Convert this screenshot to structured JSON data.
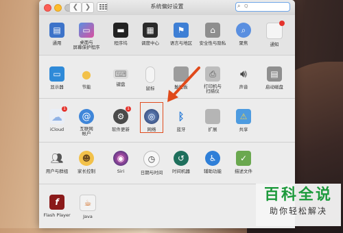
{
  "window": {
    "title": "系统偏好设置",
    "search_placeholder": "Q"
  },
  "rows": [
    {
      "items": [
        {
          "label": "通用",
          "icon": "file-new-icon"
        },
        {
          "label": "桌面与\n屏幕保护程序",
          "icon": "desktop-icon"
        },
        {
          "label": "程序坞",
          "icon": "dock-icon"
        },
        {
          "label": "调度中心",
          "icon": "mission-control-icon"
        },
        {
          "label": "语言与地区",
          "icon": "flag-icon"
        },
        {
          "label": "安全性与隐私",
          "icon": "house-lock-icon"
        },
        {
          "label": "聚焦",
          "icon": "spotlight-icon"
        },
        {
          "label": "通知",
          "icon": "notification-icon"
        }
      ]
    },
    {
      "items": [
        {
          "label": "显示器",
          "icon": "monitor-icon"
        },
        {
          "label": "节能",
          "icon": "bulb-icon"
        },
        {
          "label": "键盘",
          "icon": "keyboard-icon"
        },
        {
          "label": "鼠标",
          "icon": "mouse-icon"
        },
        {
          "label": "触控板",
          "icon": "trackpad-icon"
        },
        {
          "label": "打印机与\n扫描仪",
          "icon": "printer-icon"
        },
        {
          "label": "声音",
          "icon": "speaker-icon"
        },
        {
          "label": "启动磁盘",
          "icon": "disk-icon"
        }
      ]
    },
    {
      "items": [
        {
          "label": "iCloud",
          "icon": "icloud-icon",
          "badge": "1"
        },
        {
          "label": "互联网\n帐户",
          "icon": "at-icon"
        },
        {
          "label": "软件更新",
          "icon": "gear-icon",
          "badge": "1"
        },
        {
          "label": "网络",
          "icon": "globe-icon"
        },
        {
          "label": "蓝牙",
          "icon": "bluetooth-icon"
        },
        {
          "label": "扩展",
          "icon": "puzzle-icon"
        },
        {
          "label": "共享",
          "icon": "sharing-icon"
        }
      ]
    },
    {
      "items": [
        {
          "label": "用户与群组",
          "icon": "users-icon"
        },
        {
          "label": "家长控制",
          "icon": "parental-icon"
        },
        {
          "label": "Siri",
          "icon": "siri-icon"
        },
        {
          "label": "日期与时间",
          "icon": "clock-icon"
        },
        {
          "label": "时间机器",
          "icon": "time-machine-icon"
        },
        {
          "label": "辅助功能",
          "icon": "accessibility-icon"
        },
        {
          "label": "描述文件",
          "icon": "certificate-icon"
        }
      ]
    },
    {
      "items": [
        {
          "label": "Flash Player",
          "icon": "flash-icon"
        },
        {
          "label": "Java",
          "icon": "java-icon"
        }
      ]
    }
  ],
  "watermark": {
    "title": "百科全说",
    "subtitle": "助你轻松解决"
  },
  "colors": {
    "highlight": "#e04a1b",
    "watermark_green": "#1d9a3c"
  }
}
